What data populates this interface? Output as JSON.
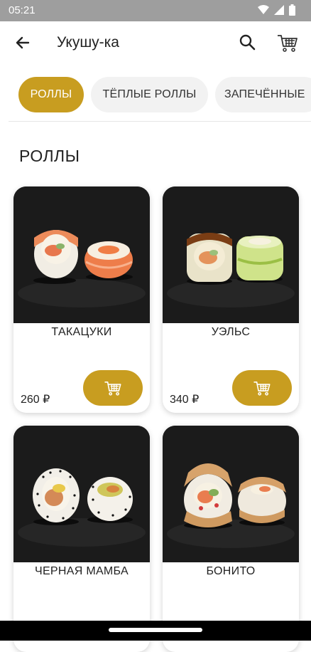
{
  "status_bar": {
    "time": "05:21"
  },
  "app_bar": {
    "title": "Укушу-ка"
  },
  "categories": [
    {
      "label": "РОЛЛЫ",
      "active": true
    },
    {
      "label": "ТЁПЛЫЕ РОЛЛЫ",
      "active": false
    },
    {
      "label": "ЗАПЕЧЁННЫЕ",
      "active": false
    }
  ],
  "section": {
    "title": "РОЛЛЫ"
  },
  "products": [
    {
      "name": "ТАКАЦУКИ",
      "price": "260 ₽"
    },
    {
      "name": "УЭЛЬС",
      "price": "340 ₽"
    },
    {
      "name": "ЧЕРНАЯ МАМБА",
      "price": ""
    },
    {
      "name": "БОНИТО",
      "price": ""
    }
  ],
  "colors": {
    "accent": "#c89d20",
    "chip_inactive": "#f2f2f2",
    "status_bar": "#9e9e9e"
  }
}
